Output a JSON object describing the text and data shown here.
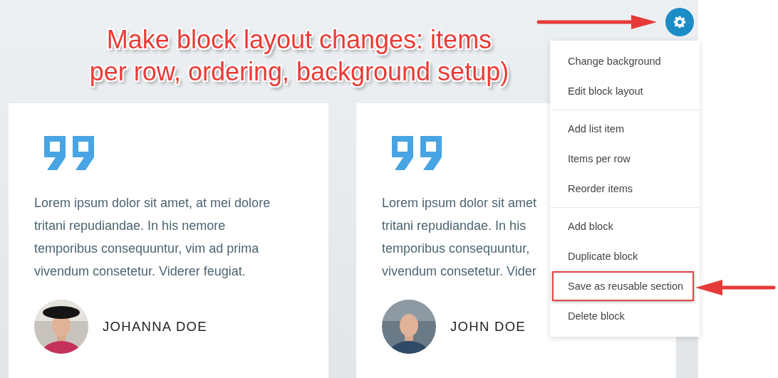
{
  "annotation": {
    "lines": [
      "Make block layout changes: items",
      "per row, ordering, background setup)"
    ]
  },
  "menu": {
    "groups": [
      {
        "items": [
          {
            "label": "Change background",
            "highlighted": false
          },
          {
            "label": "Edit block layout",
            "highlighted": false
          }
        ]
      },
      {
        "items": [
          {
            "label": "Add list item",
            "highlighted": false
          },
          {
            "label": "Items per row",
            "highlighted": false
          },
          {
            "label": "Reorder items",
            "highlighted": false
          }
        ]
      },
      {
        "items": [
          {
            "label": "Add block",
            "highlighted": false
          },
          {
            "label": "Duplicate block",
            "highlighted": false
          },
          {
            "label": "Save as reusable section",
            "highlighted": true
          },
          {
            "label": "Delete block",
            "highlighted": false
          }
        ]
      }
    ]
  },
  "testimonials": [
    {
      "lines": [
        "Lorem ipsum dolor sit amet, at mei dolore",
        "tritani repudiandae. In his nemore",
        "temporibus consequuntur, vim ad prima",
        "vivendum consetetur. Viderer feugiat."
      ],
      "name": "JOHANNA DOE"
    },
    {
      "lines": [
        "Lorem ipsum dolor sit amet",
        "tritani repudiandae. In his",
        "temporibus consequuntur,",
        "vivendum consetetur. Vider"
      ],
      "name": "JOHN DOE"
    }
  ]
}
